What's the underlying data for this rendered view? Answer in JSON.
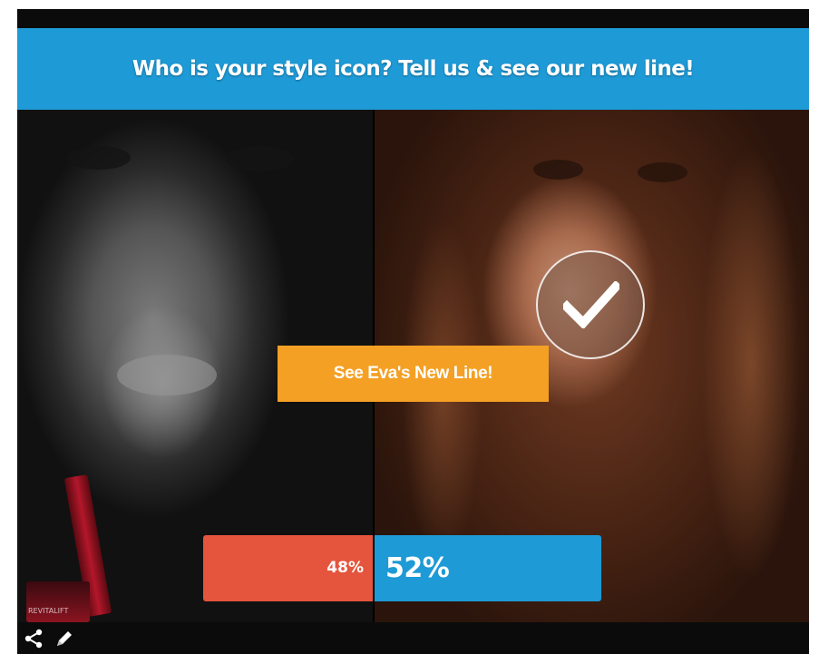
{
  "poll": {
    "title": "Who is your style icon? Tell us & see our new line!",
    "cta_label": "See Eva's New Line!",
    "results": {
      "left_percent_label": "48%",
      "right_percent_label": "52%",
      "left_percent": 48,
      "right_percent": 52
    },
    "selected_option": "right",
    "left_product_text": "REVITALIFT"
  },
  "colors": {
    "header": "#1e9ad6",
    "cta": "#f4a024",
    "left_result": "#e5553d",
    "right_result": "#1e9ad6"
  },
  "footer": {
    "icons": [
      "share-icon",
      "pencil-icon"
    ]
  }
}
